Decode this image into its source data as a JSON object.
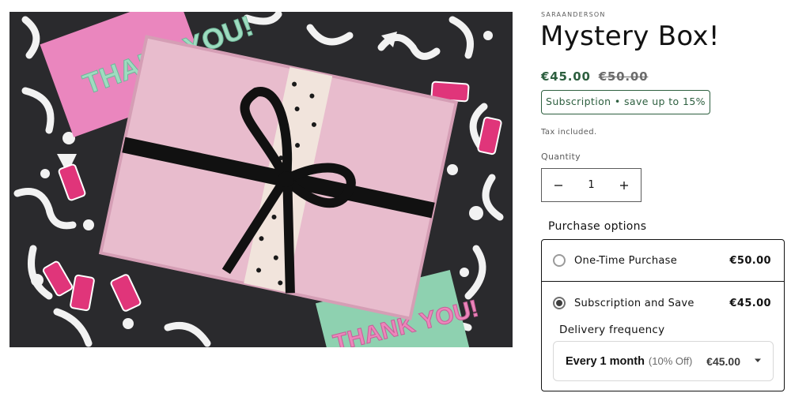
{
  "product": {
    "vendor": "SARAANDERSON",
    "title": "Mystery Box!",
    "price": "€45.00",
    "compare_price": "€50.00",
    "subscription_badge": "Subscription • save up to 15%",
    "tax_note": "Tax included.",
    "image": {
      "card_top_text": "THANK YOU!",
      "card_bottom_text": "THANK YOU!",
      "colors": {
        "background": "#2c2c2f",
        "box": "#e6b8ca",
        "ribbon": "#111111",
        "card_pink": "#ea86be",
        "card_green": "#8ed1b0"
      }
    }
  },
  "quantity": {
    "label": "Quantity",
    "value": "1",
    "decrease_icon": "minus-icon",
    "increase_icon": "plus-icon"
  },
  "purchase_options": {
    "label": "Purchase options",
    "options": [
      {
        "name": "One-Time Purchase",
        "price": "€50.00",
        "selected": false
      },
      {
        "name": "Subscription and Save",
        "price": "€45.00",
        "selected": true
      }
    ],
    "delivery_frequency": {
      "label": "Delivery frequency",
      "selected": "Every 1 month",
      "discount": "(10% Off)",
      "price": "€45.00",
      "icon": "chevron-down-icon"
    }
  },
  "colors": {
    "accent_green": "#2d5f3f",
    "text": "#121212",
    "muted": "#5c5c5c"
  }
}
